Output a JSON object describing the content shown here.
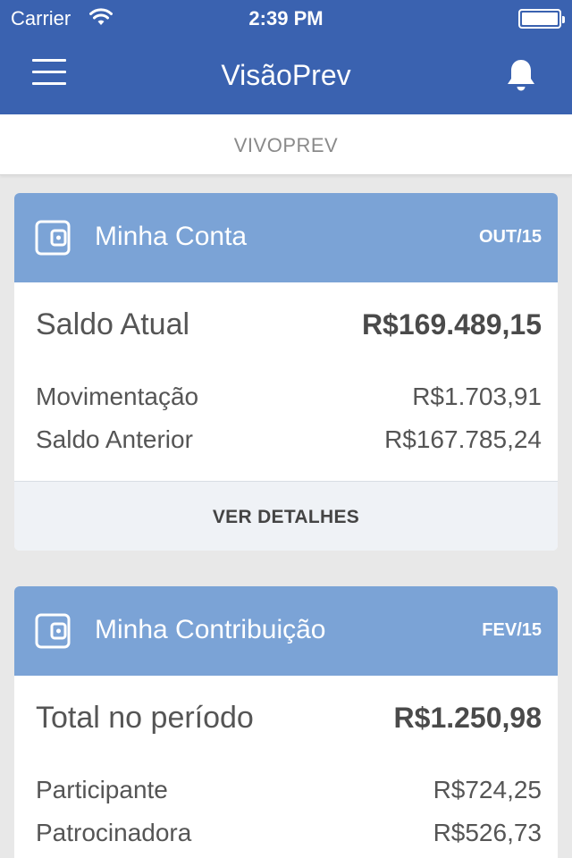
{
  "status_bar": {
    "carrier": "Carrier",
    "time": "2:39 PM"
  },
  "nav": {
    "title": "VisãoPrev"
  },
  "subheader": {
    "label": "VIVOPREV"
  },
  "cards": [
    {
      "title": "Minha Conta",
      "period": "OUT/15",
      "main": {
        "label": "Saldo Atual",
        "value": "R$169.489,15"
      },
      "rows": [
        {
          "label": "Movimentação",
          "value": "R$1.703,91"
        },
        {
          "label": "Saldo Anterior",
          "value": "R$167.785,24"
        }
      ],
      "action": "VER DETALHES"
    },
    {
      "title": "Minha Contribuição",
      "period": "FEV/15",
      "main": {
        "label": "Total no período",
        "value": "R$1.250,98"
      },
      "rows": [
        {
          "label": "Participante",
          "value": "R$724,25"
        },
        {
          "label": "Patrocinadora",
          "value": "R$526,73"
        }
      ]
    }
  ],
  "colors": {
    "nav_blue": "#3a62b0",
    "card_header_blue": "#7ba3d6",
    "background": "#e8e8e8"
  },
  "icons": {
    "menu": "hamburger-icon",
    "notifications": "bell-icon",
    "card": "wallet-icon",
    "wifi": "wifi-icon",
    "battery": "battery-icon"
  }
}
